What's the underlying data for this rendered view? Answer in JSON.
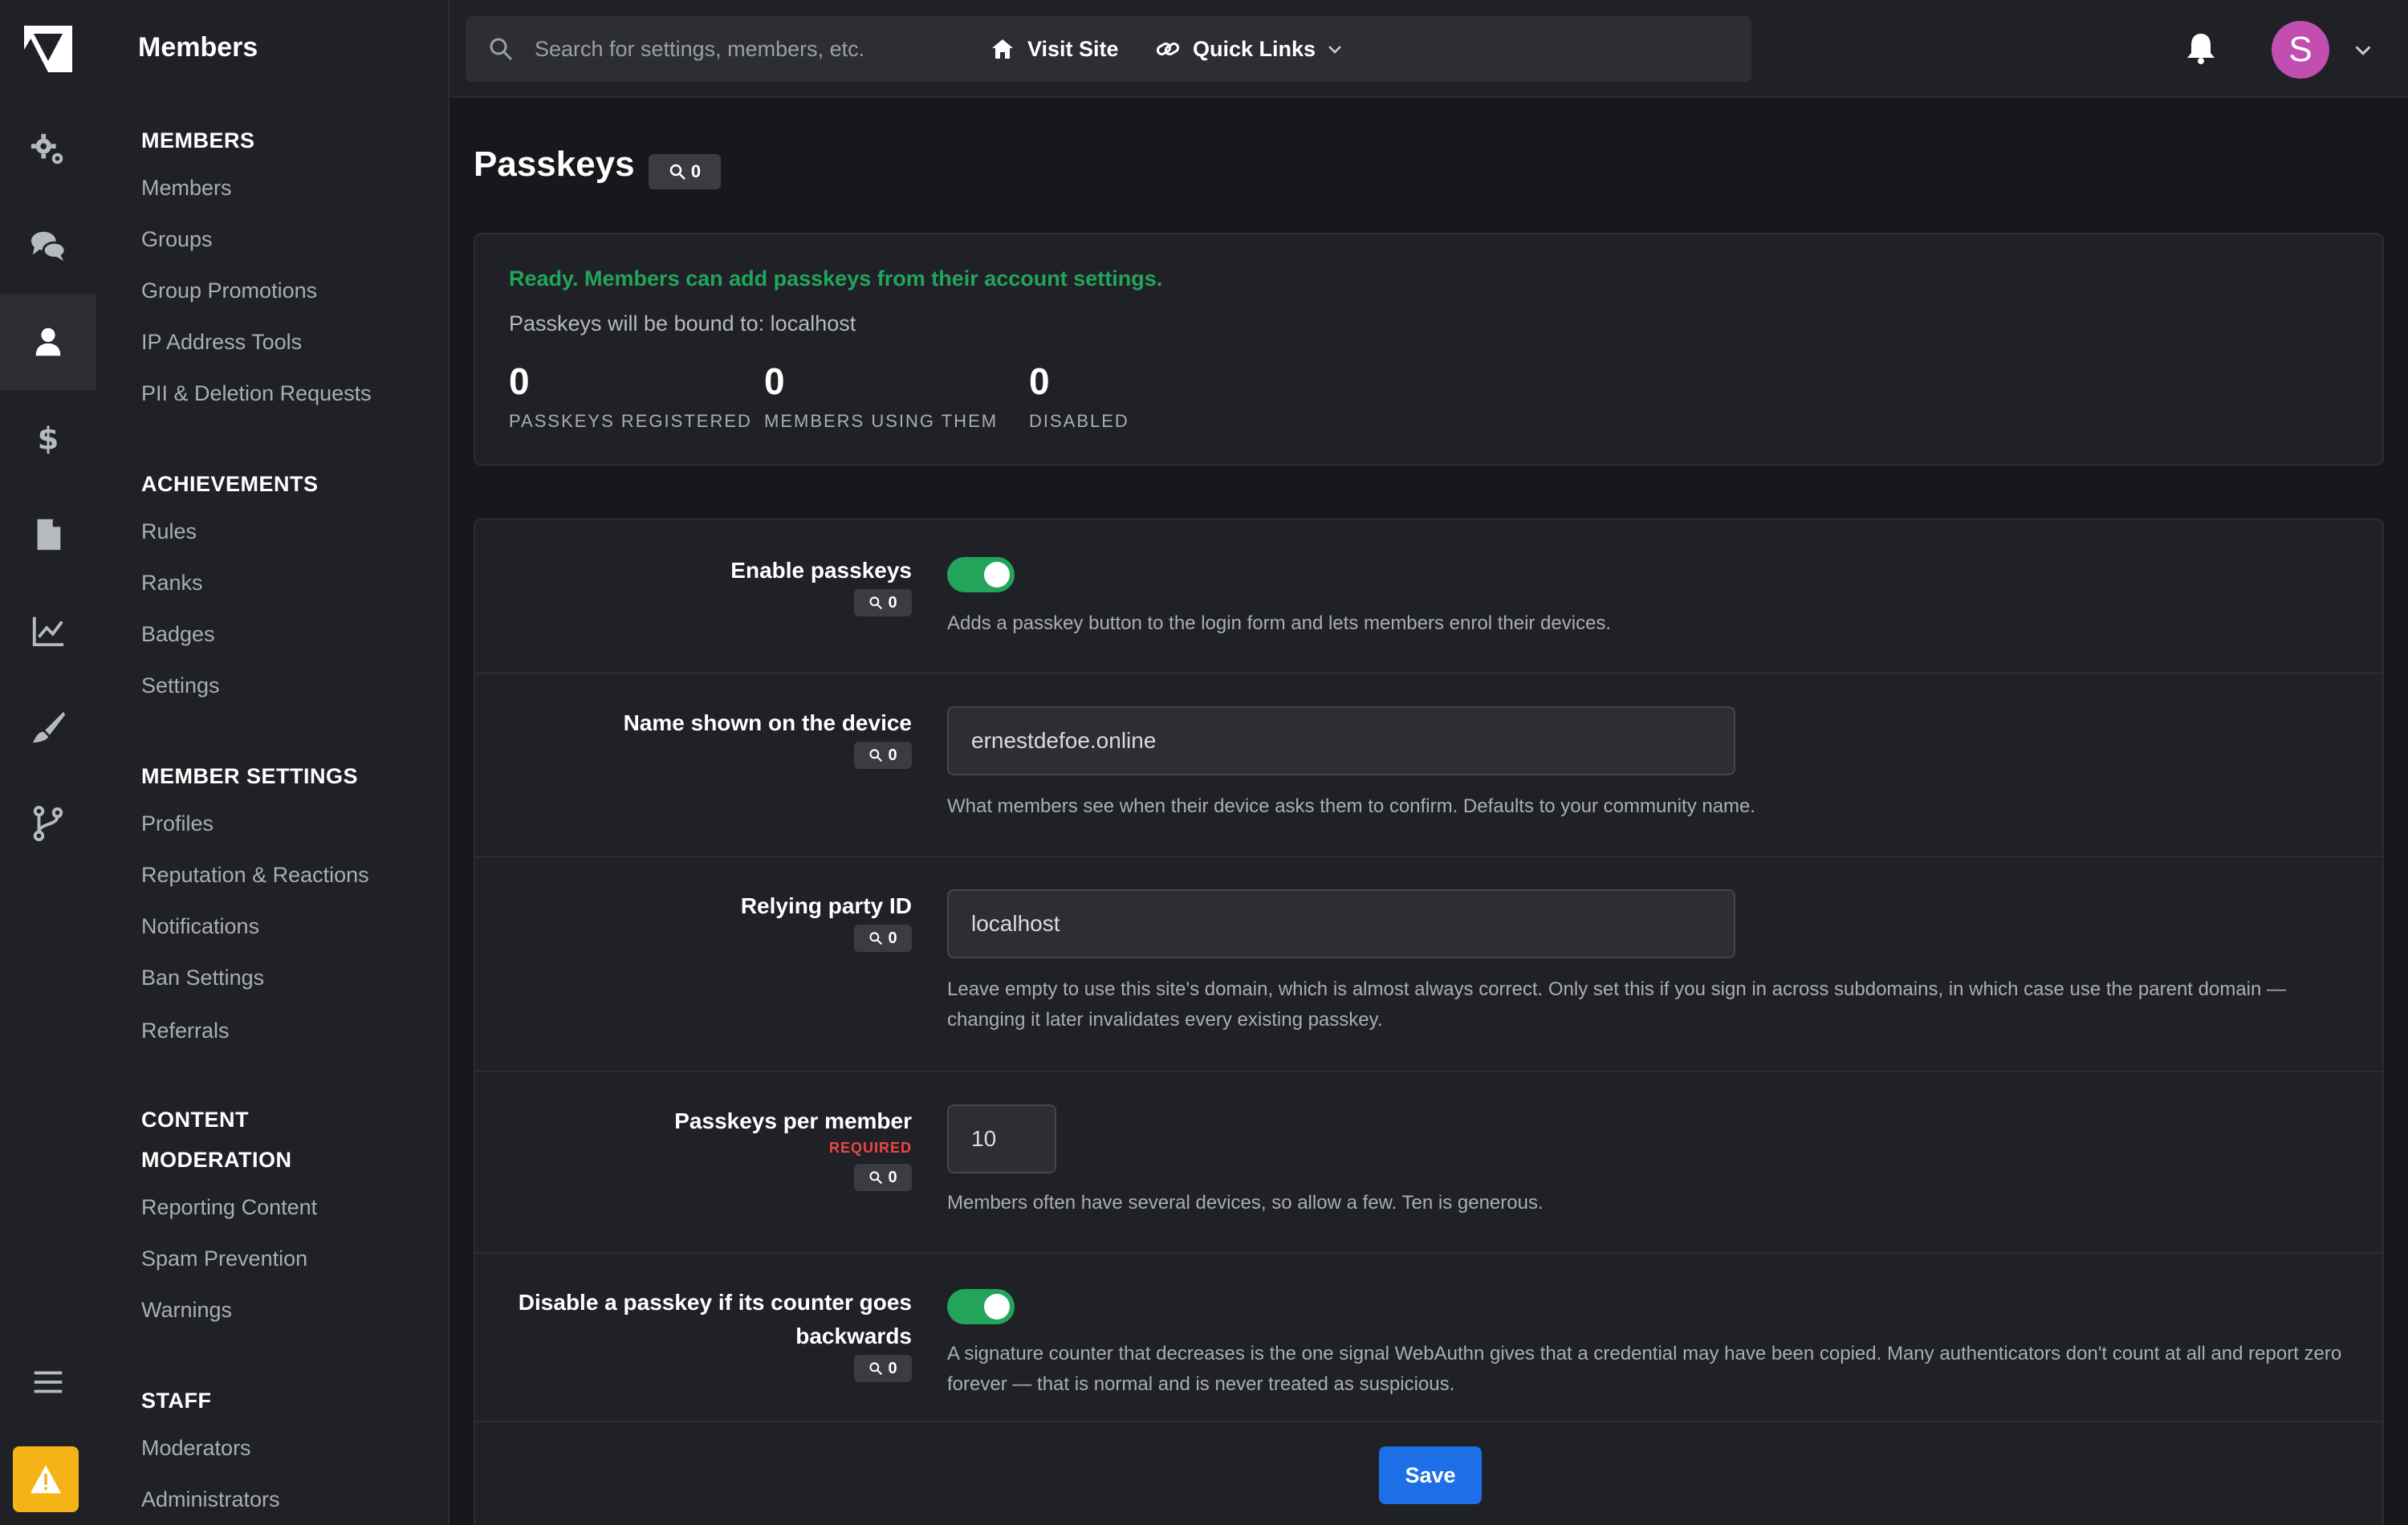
{
  "colors": {
    "accent": "#1d6fe8",
    "success": "#22a55b",
    "danger": "#ef4444",
    "warning": "#f4b417",
    "avatar": "#c24fb0"
  },
  "rail": {
    "items": [
      {
        "icon": "gears-icon"
      },
      {
        "icon": "chat-bubbles-icon"
      },
      {
        "icon": "member-icon",
        "active": true
      },
      {
        "icon": "dollar-icon"
      },
      {
        "icon": "document-icon"
      },
      {
        "icon": "chart-line-icon"
      },
      {
        "icon": "paintbrush-icon"
      },
      {
        "icon": "code-branch-icon"
      },
      {
        "icon": "menu-icon"
      },
      {
        "icon": "warning-icon"
      }
    ]
  },
  "sidenav": {
    "title": "Members",
    "groups": [
      {
        "title": "MEMBERS",
        "items": [
          "Members",
          "Groups",
          "Group Promotions",
          "IP Address Tools",
          "PII & Deletion Requests"
        ]
      },
      {
        "title": "ACHIEVEMENTS",
        "items": [
          "Rules",
          "Ranks",
          "Badges",
          "Settings"
        ]
      },
      {
        "title": "MEMBER SETTINGS",
        "items": [
          "Profiles",
          "Reputation & Reactions",
          "Notifications",
          "Ban Settings",
          "Referrals"
        ]
      },
      {
        "title": "CONTENT MODERATION",
        "items": [
          "Reporting Content",
          "Spam Prevention",
          "Warnings"
        ]
      },
      {
        "title": "STAFF",
        "items": [
          "Moderators",
          "Administrators"
        ]
      }
    ]
  },
  "topbar": {
    "search_placeholder": "Search for settings, members, etc.",
    "visit_site": "Visit Site",
    "quick_links": "Quick Links",
    "avatar_letter": "S"
  },
  "page": {
    "title": "Passkeys",
    "search_count": "0"
  },
  "status": {
    "ready": "Ready. Members can add passkeys from their account settings.",
    "bound_to": "Passkeys will be bound to: localhost",
    "stats": [
      {
        "value": "0",
        "label": "PASSKEYS REGISTERED"
      },
      {
        "value": "0",
        "label": "MEMBERS USING THEM"
      },
      {
        "value": "0",
        "label": "DISABLED"
      }
    ]
  },
  "settings": {
    "enable": {
      "label": "Enable passkeys",
      "count": "0",
      "help": "Adds a passkey button to the login form and lets members enrol their devices."
    },
    "device_name": {
      "label": "Name shown on the device",
      "count": "0",
      "value": "ernestdefoe.online",
      "help": "What members see when their device asks them to confirm. Defaults to your community name."
    },
    "rp_id": {
      "label": "Relying party ID",
      "count": "0",
      "value": "localhost",
      "help": "Leave empty to use this site's domain, which is almost always correct. Only set this if you sign in across subdomains, in which case use the parent domain — changing it later invalidates every existing passkey."
    },
    "per_member": {
      "label": "Passkeys per member",
      "required": "REQUIRED",
      "count": "0",
      "value": "10",
      "help": "Members often have several devices, so allow a few. Ten is generous."
    },
    "counter": {
      "label": "Disable a passkey if its counter goes backwards",
      "count": "0",
      "help": "A signature counter that decreases is the one signal WebAuthn gives that a credential may have been copied. Many authenticators don't count at all and report zero forever — that is normal and is never treated as suspicious."
    },
    "save_label": "Save"
  }
}
